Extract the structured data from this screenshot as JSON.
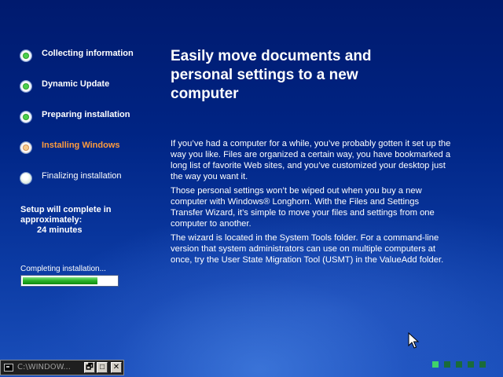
{
  "steps": [
    {
      "label": "Collecting information",
      "state": "done"
    },
    {
      "label": "Dynamic Update",
      "state": "done"
    },
    {
      "label": "Preparing installation",
      "state": "done"
    },
    {
      "label": "Installing Windows",
      "state": "current"
    },
    {
      "label": "Finalizing installation",
      "state": "pending"
    }
  ],
  "eta": {
    "line1": "Setup will complete in",
    "line2": "approximately:",
    "minutes": "24 minutes"
  },
  "progress": {
    "label": "Completing installation...",
    "fraction": 0.8
  },
  "content": {
    "headline": "Easily move documents and personal settings to a new computer",
    "paragraphs": [
      "If you’ve had a computer for a while, you’ve probably gotten it set up the way you like. Files are organized a certain way, you have bookmarked a long list of favorite Web sites, and you’ve customized your desktop just the way you want it.",
      "Those personal settings won’t be wiped out when you buy a new computer with Windows® Longhorn. With the Files and Settings Transfer Wizard, it’s simple to move your files and settings from one computer to another.",
      "The wizard is located in the System Tools folder. For a command-line version that system administrators can use on multiple computers at once, try the User State Migration Tool (USMT) in the ValueAdd folder."
    ]
  },
  "taskbar": {
    "title": "C:\\WINDOW...",
    "restore_glyph": "🗗",
    "max_glyph": "□",
    "close_glyph": "✕"
  },
  "dots": {
    "count": 5,
    "active_index": 0
  },
  "colors": {
    "accent_current": "#ff9b3d",
    "progress_green": "#2cb52c",
    "bg_blue": "#0b3aa3"
  }
}
